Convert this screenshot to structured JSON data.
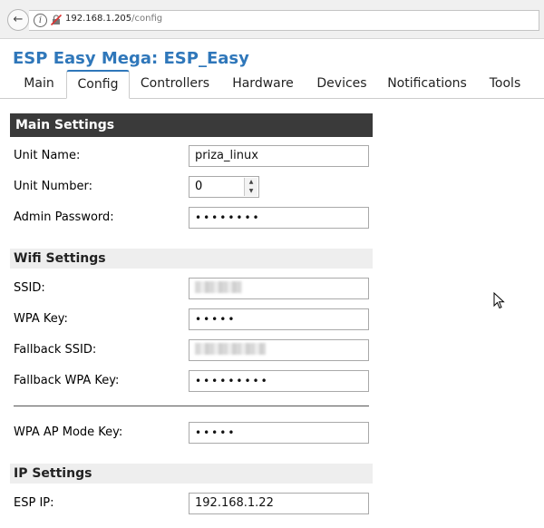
{
  "browser": {
    "url_host": "192.168.1.205",
    "url_path": "/config"
  },
  "page": {
    "title": "ESP Easy Mega: ESP_Easy"
  },
  "tabs": [
    {
      "label": "Main",
      "active": false
    },
    {
      "label": "Config",
      "active": true
    },
    {
      "label": "Controllers",
      "active": false
    },
    {
      "label": "Hardware",
      "active": false
    },
    {
      "label": "Devices",
      "active": false
    },
    {
      "label": "Notifications",
      "active": false
    },
    {
      "label": "Tools",
      "active": false
    }
  ],
  "main_settings": {
    "header": "Main Settings",
    "unit_name_label": "Unit Name:",
    "unit_name_value": "priza_linux",
    "unit_number_label": "Unit Number:",
    "unit_number_value": "0",
    "admin_password_label": "Admin Password:",
    "admin_password_value": "••••••••"
  },
  "wifi_settings": {
    "header": "Wifi Settings",
    "ssid_label": "SSID:",
    "wpa_key_label": "WPA Key:",
    "wpa_key_value": "•••••",
    "fallback_ssid_label": "Fallback SSID:",
    "fallback_wpa_key_label": "Fallback WPA Key:",
    "fallback_wpa_key_value": "•••••••••",
    "wpa_ap_mode_key_label": "WPA AP Mode Key:",
    "wpa_ap_mode_key_value": "•••••"
  },
  "ip_settings": {
    "header": "IP Settings",
    "esp_ip_label": "ESP IP:",
    "esp_ip_value": "192.168.1.22"
  },
  "colors": {
    "title": "#2f77ba",
    "header_bg": "#3a3a3a",
    "subheader_bg": "#eeeeee"
  }
}
